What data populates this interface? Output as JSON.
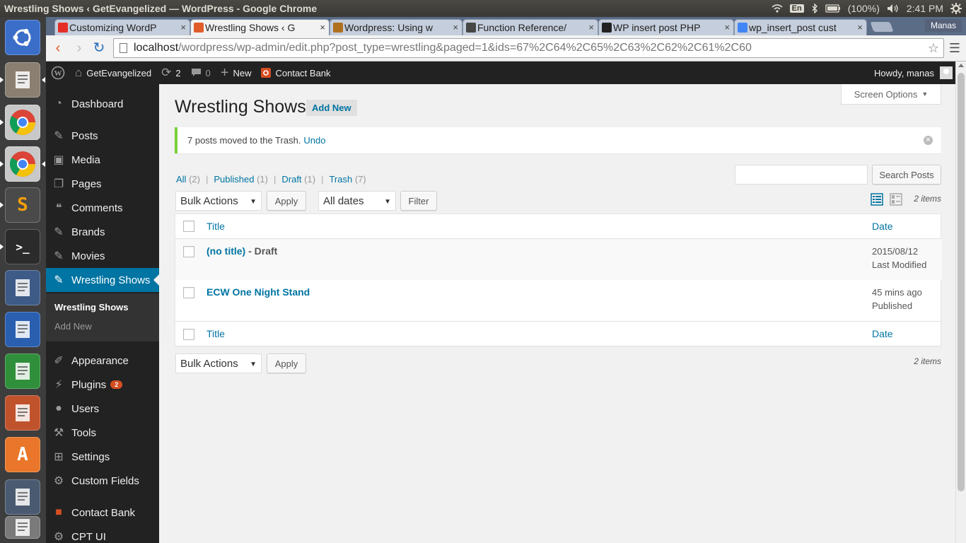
{
  "os_panel": {
    "window_title": "Wrestling Shows ‹ GetEvangelized — WordPress - Google Chrome",
    "lang": "En",
    "battery": "(100%)",
    "time": "2:41 PM"
  },
  "launcher": [
    {
      "name": "ubuntu-dash-icon"
    },
    {
      "name": "files-icon"
    },
    {
      "name": "chrome-icon"
    },
    {
      "name": "chrome-icon"
    },
    {
      "name": "sublime-text-icon",
      "glyph": "S"
    },
    {
      "name": "terminal-icon",
      "glyph": ">_"
    },
    {
      "name": "text-editor-icon"
    },
    {
      "name": "libreoffice-writer-icon"
    },
    {
      "name": "libreoffice-calc-icon"
    },
    {
      "name": "libreoffice-impress-icon"
    },
    {
      "name": "software-center-icon",
      "glyph": "A"
    },
    {
      "name": "system-settings-icon"
    },
    {
      "name": "drive-icon"
    }
  ],
  "browser": {
    "tabs": [
      {
        "title": "Customizing WordP",
        "favicon": "youtube-icon",
        "color": "#e52d27",
        "active": false
      },
      {
        "title": "Wrestling Shows ‹ G",
        "favicon": "wordpress-page-icon",
        "color": "#e05d2b",
        "active": true
      },
      {
        "title": "Wordpress: Using w",
        "favicon": "document-icon",
        "color": "#b07020",
        "active": false
      },
      {
        "title": "Function Reference/",
        "favicon": "wordpress-icon",
        "color": "#464646",
        "active": false
      },
      {
        "title": "WP insert post PHP",
        "favicon": "wordpress-w-icon",
        "color": "#222222",
        "active": false
      },
      {
        "title": "wp_insert_post cust",
        "favicon": "google-icon",
        "color": "#4285f4",
        "active": false
      }
    ],
    "profile_name": "Manas",
    "url_host": "localhost",
    "url_rest": "/wordpress/wp-admin/edit.php?post_type=wrestling&paged=1&ids=67%2C64%2C65%2C63%2C62%2C61%2C60"
  },
  "admin_bar": {
    "site_name": "GetEvangelized",
    "updates_count": "2",
    "comments_count": "0",
    "new_label": "New",
    "contact_bank": "Contact Bank",
    "howdy": "Howdy, manas"
  },
  "sidebar": {
    "items": [
      {
        "label": "Dashboard",
        "icon": "dashboard-icon"
      },
      {
        "label": "Posts",
        "icon": "pin-icon"
      },
      {
        "label": "Media",
        "icon": "media-icon"
      },
      {
        "label": "Pages",
        "icon": "pages-icon"
      },
      {
        "label": "Comments",
        "icon": "comments-icon"
      },
      {
        "label": "Brands",
        "icon": "pin-icon"
      },
      {
        "label": "Movies",
        "icon": "pin-icon"
      },
      {
        "label": "Wrestling Shows",
        "icon": "pin-icon",
        "current": true
      },
      {
        "label": "Appearance",
        "icon": "brush-icon"
      },
      {
        "label": "Plugins",
        "icon": "plugin-icon",
        "badge": "2"
      },
      {
        "label": "Users",
        "icon": "users-icon"
      },
      {
        "label": "Tools",
        "icon": "wrench-icon"
      },
      {
        "label": "Settings",
        "icon": "settings-icon"
      },
      {
        "label": "Custom Fields",
        "icon": "gear-icon"
      },
      {
        "label": "Contact Bank",
        "icon": "contact-bank-icon"
      },
      {
        "label": "CPT UI",
        "icon": "gear-icon"
      }
    ],
    "submenu": [
      "Wrestling Shows",
      "Add New"
    ]
  },
  "main": {
    "screen_options": "Screen Options",
    "title": "Wrestling Shows",
    "add_new": "Add New",
    "notice_text": "7 posts moved to the Trash.",
    "notice_link": "Undo",
    "filters": [
      {
        "label": "All",
        "count": "(2)"
      },
      {
        "label": "Published",
        "count": "(1)"
      },
      {
        "label": "Draft",
        "count": "(1)"
      },
      {
        "label": "Trash",
        "count": "(7)"
      }
    ],
    "search_button": "Search Posts",
    "bulk_actions": "Bulk Actions",
    "apply": "Apply",
    "all_dates": "All dates",
    "filter": "Filter",
    "items_count": "2 items",
    "columns": {
      "title": "Title",
      "date": "Date"
    },
    "rows": [
      {
        "title": "(no title)",
        "state": " - Draft",
        "date": "2015/08/12",
        "status": "Last Modified"
      },
      {
        "title": "ECW One Night Stand",
        "state": "",
        "date": "45 mins ago",
        "status": "Published"
      }
    ]
  }
}
